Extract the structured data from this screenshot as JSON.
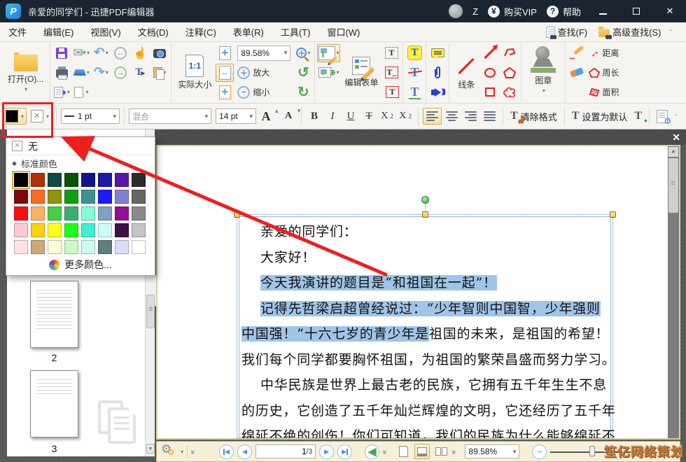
{
  "title_bar": {
    "app_title": "亲爱的同学们 - 迅捷PDF编辑器",
    "user_initial": "Z",
    "buy_vip_label": "购买VIP",
    "buy_vip_symbol": "¥",
    "help_label": "帮助",
    "help_symbol": "?"
  },
  "menu_bar": {
    "items": [
      "文件",
      "编辑(E)",
      "视图(V)",
      "文档(D)",
      "注释(C)",
      "表单(R)",
      "工具(T)",
      "窗口(W)"
    ],
    "find_label": "查找(F)",
    "advanced_find_label": "高级查找(S)"
  },
  "toolbar": {
    "open_label": "打开(O)...",
    "actual_size_label": "实际大小",
    "zoom_value": "89.58%",
    "zoom_in_label": "放大",
    "zoom_out_label": "缩小",
    "edit_form_label": "编辑表单",
    "line_label": "线条",
    "stamp_label": "图章",
    "distance_label": "距离",
    "perimeter_label": "周长",
    "area_label": "面积"
  },
  "format_bar": {
    "line_width_value": "1 pt",
    "font_name_value": "混合",
    "font_size_value": "14 pt",
    "bold_label": "B",
    "italic_label": "I",
    "underline_label": "U",
    "strike_label": "T",
    "sub_label": "X",
    "sub_small": "2",
    "sup_label": "X",
    "sup_small": "2",
    "clear_format_label": "清除格式",
    "set_default_label": "设置为默认"
  },
  "color_picker": {
    "none_label": "无",
    "standard_colors_label": "标准颜色",
    "more_colors_label": "更多颜色...",
    "selected": "#000000",
    "rows": [
      [
        "#000000",
        "#b03109",
        "#0d4a45",
        "#0a520a",
        "#12138a",
        "#1a1aa8",
        "#5c16a8",
        "#2b2b2b"
      ],
      [
        "#7e0b0b",
        "#f96a23",
        "#8f940e",
        "#0fa00f",
        "#3e9191",
        "#1b1bff",
        "#8182cf",
        "#666666"
      ],
      [
        "#ff0d0d",
        "#ffb061",
        "#42d242",
        "#3cae73",
        "#83ffd1",
        "#81a0c7",
        "#960e96",
        "#8a8a8a"
      ],
      [
        "#ffc7d4",
        "#ffd20e",
        "#ffff1b",
        "#1bff1b",
        "#42edd2",
        "#c9fff8",
        "#400e4a",
        "#c4c4c4"
      ],
      [
        "#ffe2e8",
        "#cfa877",
        "#fdfdd9",
        "#c9fcc2",
        "#c9fcf2",
        "#607f7f",
        "#dcdcf7",
        "#ffffff"
      ]
    ]
  },
  "sidebar": {
    "thumbnails": [
      {
        "page_number": "2"
      },
      {
        "page_number": "3"
      }
    ]
  },
  "document": {
    "lines": [
      {
        "indent": true,
        "segments": [
          {
            "text": "亲爱的同学们：",
            "highlight": false
          }
        ]
      },
      {
        "indent": true,
        "segments": [
          {
            "text": "大家好！",
            "highlight": false
          }
        ]
      },
      {
        "indent": true,
        "segments": [
          {
            "text": "今天我演讲的题目是“和祖国在一起”！",
            "highlight": true
          }
        ]
      },
      {
        "indent": true,
        "segments": [
          {
            "text": "记得先哲梁启超曾经说过：“少年智则中国智，少年强则",
            "highlight": true
          }
        ]
      },
      {
        "indent": false,
        "segments": [
          {
            "text": "中国强！”十六七岁的青少年是",
            "highlight": true
          },
          {
            "text": "祖国的未来，是祖国的希望！",
            "highlight": false
          }
        ]
      },
      {
        "indent": false,
        "segments": [
          {
            "text": "我们每个同学都要胸怀祖国，为祖国的繁荣昌盛而努力学习。",
            "highlight": false
          }
        ]
      },
      {
        "indent": true,
        "segments": [
          {
            "text": "中华民族是世界上最古老的民族，它拥有五千年生生不息",
            "highlight": false
          }
        ]
      },
      {
        "indent": false,
        "segments": [
          {
            "text": "的历史，它创造了五千年灿烂辉煌的文明，它还经历了五千年",
            "highlight": false
          }
        ]
      },
      {
        "indent": false,
        "segments": [
          {
            "text": "绵延不绝的创伤！你们可知道，我们的民族为什么能够绵延不",
            "highlight": false
          }
        ]
      }
    ]
  },
  "status_bar": {
    "page_input_value": "1",
    "page_total_label": "/3",
    "zoom_value": "89.58%"
  },
  "watermark_text": "笙亿网络策划"
}
